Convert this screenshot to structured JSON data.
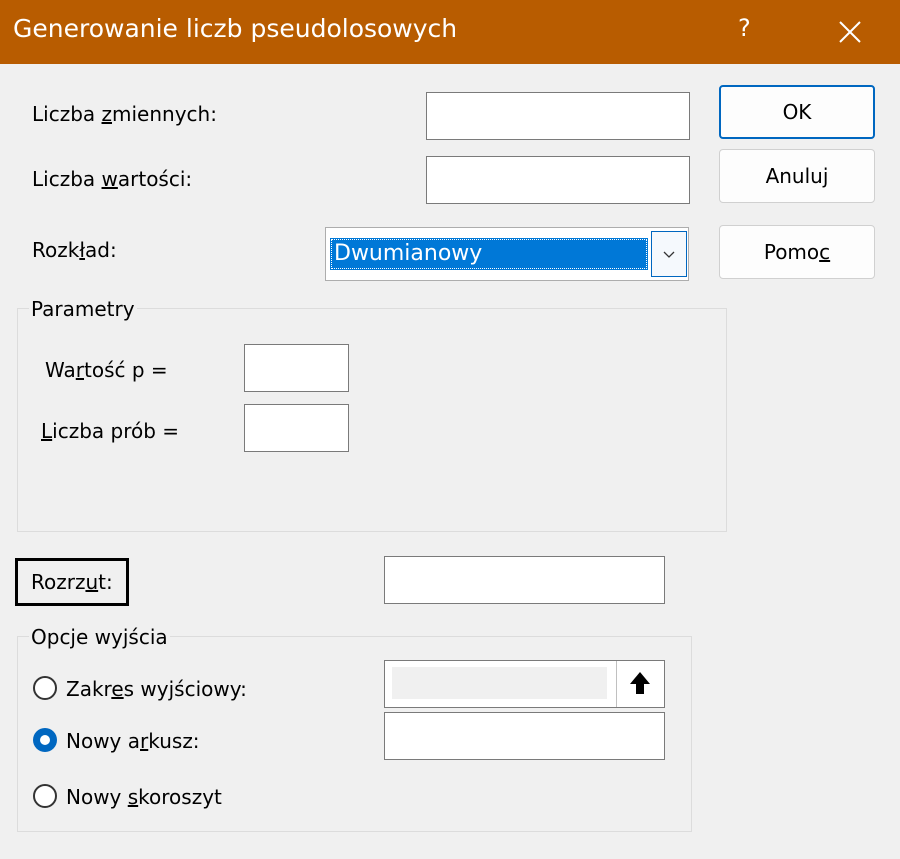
{
  "window": {
    "title": "Generowanie liczb pseudolosowych",
    "help_glyph": "?",
    "close_icon": "close-icon"
  },
  "fields": {
    "num_variables": {
      "pre": "Liczba ",
      "u": "z",
      "post": "miennych:",
      "value": ""
    },
    "num_values": {
      "pre": "Liczba ",
      "u": "w",
      "post": "artości:",
      "value": ""
    },
    "distribution": {
      "pre": "Rozk",
      "u": "ł",
      "post": "ad:",
      "value": "Dwumianowy"
    }
  },
  "buttons": {
    "ok": "OK",
    "cancel": "Anuluj",
    "help": {
      "pre": "Pomo",
      "u": "c",
      "post": ""
    }
  },
  "parameters": {
    "title": "Parametry",
    "p_value": {
      "pre": "Wa",
      "u": "r",
      "post": "tość p =",
      "value": ""
    },
    "trials": {
      "pre": "",
      "u": "L",
      "post": "iczba prób =",
      "value": ""
    }
  },
  "seed": {
    "pre": "Rozrz",
    "u": "u",
    "post": "t:",
    "value": ""
  },
  "output": {
    "title": "Opcje wyjścia",
    "range": {
      "pre": "Zakr",
      "u": "e",
      "post": "s wyjściowy:",
      "checked": false
    },
    "new_sheet": {
      "pre": "Nowy a",
      "u": "r",
      "post": "kusz:",
      "checked": true
    },
    "new_workbook": {
      "pre": "Nowy ",
      "u": "s",
      "post": "koroszyt",
      "checked": false
    }
  },
  "colors": {
    "titlebar": "#b85c00",
    "accent": "#0067c0",
    "selection": "#0078d7"
  }
}
